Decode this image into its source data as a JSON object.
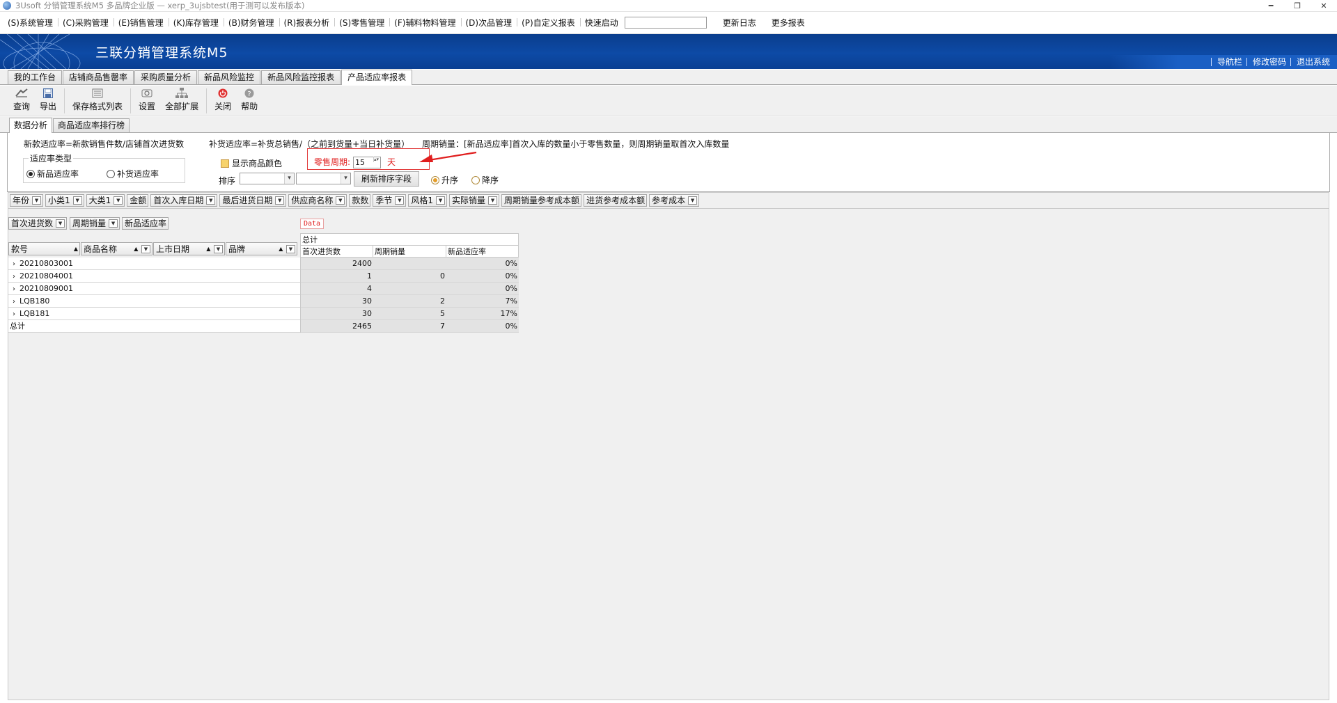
{
  "titlebar": {
    "title": "3Usoft 分销管理系统M5 多品牌企业版 — xerp_3ujsbtest(用于测可以发布版本)",
    "min": "━",
    "max": "❐",
    "close": "✕"
  },
  "menu": {
    "items": [
      "(S)系统管理",
      "(C)采购管理",
      "(E)销售管理",
      "(K)库存管理",
      "(B)财务管理",
      "(R)报表分析",
      "(S)零售管理",
      "(F)辅料物料管理",
      "(D)次品管理",
      "(P)自定义报表"
    ],
    "quick_label": "快速启动",
    "quick_value": "",
    "changelog": "更新日志",
    "more_reports": "更多报表"
  },
  "banner": {
    "title": "三联分销管理系统M5",
    "nav": "导航栏",
    "password": "修改密码",
    "exit": "退出系统"
  },
  "tabs": [
    "我的工作台",
    "店铺商品售罄率",
    "采购质量分析",
    "新品风险监控",
    "新品风险监控报表",
    "产品适应率报表"
  ],
  "active_tab": 5,
  "toolbar": {
    "query": "查询",
    "export": "导出",
    "save_format": "保存格式列表",
    "settings": "设置",
    "expand_all": "全部扩展",
    "close": "关闭",
    "help": "帮助"
  },
  "subtabs": [
    "数据分析",
    "商品适应率排行榜"
  ],
  "form": {
    "formula_new": "新款适应率=新款销售件数/店铺首次进货数",
    "formula_replenish": "补货适应率=补货总销售/（之前到货量+当日补货量）",
    "period_note": "周期销量：[新品适应率]首次入库的数量小于零售数量，则周期销量取首次入库数量",
    "group_label": "适应率类型",
    "radio_new": "新品适应率",
    "radio_replenish": "补货适应率",
    "show_color": "显示商品颜色",
    "sort_label": "排序",
    "refresh_sort": "刷新排序字段",
    "asc": "升序",
    "desc": "降序",
    "cycle_label": "零售周期:",
    "cycle_value": "15",
    "cycle_unit": "天"
  },
  "field_buttons": [
    "年份",
    "小类1",
    "大类1",
    "金额",
    "首次入库日期",
    "最后进货日期",
    "供应商名称",
    "款数",
    "季节",
    "风格1",
    "实际销量",
    "周期销量参考成本额",
    "进货参考成本额",
    "参考成本"
  ],
  "data_fields": [
    "首次进货数",
    "周期销量",
    "新品适应率"
  ],
  "data_tag": "Data",
  "row_headers": [
    "款号",
    "商品名称",
    "上市日期",
    "品牌"
  ],
  "col_header_total": "总计",
  "col_headers": [
    "首次进货数",
    "周期销量",
    "新品适应率"
  ],
  "rows": [
    {
      "code": "20210803001",
      "first_qty": "2400",
      "period": "",
      "rate": "0%"
    },
    {
      "code": "20210804001",
      "first_qty": "1",
      "period": "0",
      "rate": "0%"
    },
    {
      "code": "20210809001",
      "first_qty": "4",
      "period": "",
      "rate": "0%"
    },
    {
      "code": "LQB180",
      "first_qty": "30",
      "period": "2",
      "rate": "7%"
    },
    {
      "code": "LQB181",
      "first_qty": "30",
      "period": "5",
      "rate": "17%"
    }
  ],
  "total": {
    "label": "总计",
    "first_qty": "2465",
    "period": "7",
    "rate": "0%"
  },
  "colors": {
    "banner": "#0d4aa6",
    "highlight": "#e01e1e",
    "cell_gray": "#e3e3e3"
  }
}
